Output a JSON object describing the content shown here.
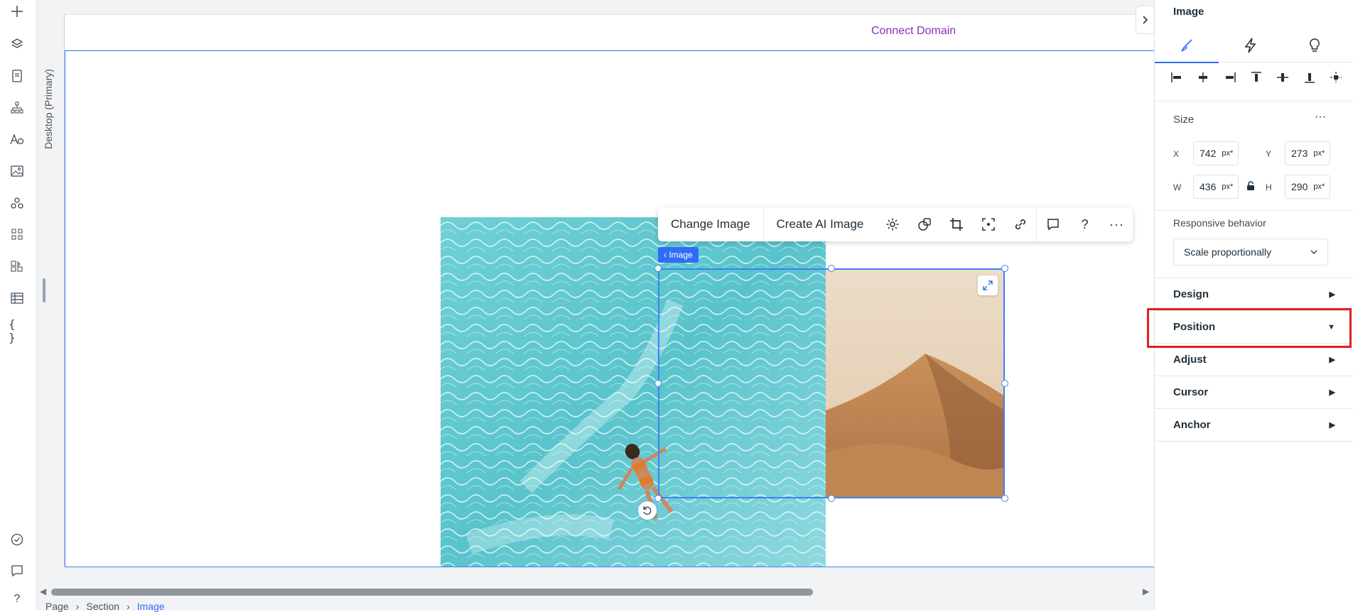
{
  "left_bar": {
    "icons": [
      "plus-icon",
      "layers-icon",
      "pages-icon",
      "sitemap-icon",
      "text-theme-icon",
      "media-icon",
      "components-icon",
      "apps-icon",
      "business-apps-icon",
      "table-icon",
      "code-icon",
      "checklist-icon",
      "chat-icon",
      "help-icon"
    ]
  },
  "canvas": {
    "device_label": "Desktop (Primary)",
    "connect_domain": "Connect Domain",
    "image_tag": "‹ Image"
  },
  "float_toolbar": {
    "change_image": "Change Image",
    "create_ai_image": "Create AI Image",
    "icons": [
      "settings-icon",
      "layers-overlap-icon",
      "crop-icon",
      "focal-point-icon",
      "link-icon",
      "comment-icon",
      "help-icon",
      "more-icon"
    ]
  },
  "breadcrumb": {
    "items": [
      "Page",
      "Section",
      "Image"
    ]
  },
  "right_panel": {
    "title": "Image",
    "tabs": [
      "design-brush-icon",
      "interactions-bolt-icon",
      "ai-bulb-icon"
    ],
    "size": {
      "label": "Size",
      "more": "···",
      "x_label": "X",
      "x_value": "742",
      "x_unit": "px*",
      "y_label": "Y",
      "y_value": "273",
      "y_unit": "px*",
      "w_label": "W",
      "w_value": "436",
      "w_unit": "px*",
      "h_label": "H",
      "h_value": "290",
      "h_unit": "px*"
    },
    "responsive": {
      "label": "Responsive behavior",
      "value": "Scale proportionally"
    },
    "sections": [
      {
        "label": "Design",
        "arrow": "▶"
      },
      {
        "label": "Position",
        "arrow": "▼"
      },
      {
        "label": "Adjust",
        "arrow": "▶"
      },
      {
        "label": "Cursor",
        "arrow": "▶"
      },
      {
        "label": "Anchor",
        "arrow": "▶"
      }
    ]
  },
  "colors": {
    "accent": "#2f6df6",
    "selection": "#3b82f6",
    "domain_link": "#8a2fc3",
    "highlight": "#e02020"
  }
}
